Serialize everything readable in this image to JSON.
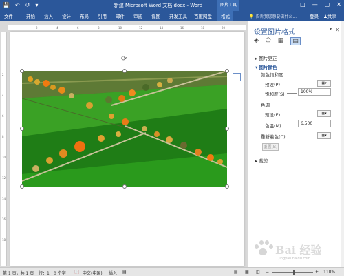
{
  "titlebar": {
    "doc_title": "新建 Microsoft Word 文档.docx - Word",
    "context_tool": "图片工具",
    "qat_icons": [
      "save-icon",
      "undo-icon",
      "redo-icon",
      "customize-icon"
    ]
  },
  "tabs": [
    {
      "label": "文件"
    },
    {
      "label": "开始"
    },
    {
      "label": "插入"
    },
    {
      "label": "设计"
    },
    {
      "label": "布局"
    },
    {
      "label": "引用"
    },
    {
      "label": "邮件"
    },
    {
      "label": "审阅"
    },
    {
      "label": "视图"
    },
    {
      "label": "开发工具"
    },
    {
      "label": "百度网盘"
    },
    {
      "label": "格式"
    }
  ],
  "tellme": "告诉我您想要做什么...",
  "login": "登录",
  "share": "共享",
  "pane": {
    "title": "设置图片格式",
    "sections": {
      "correction": "图片更正",
      "color": "图片颜色",
      "crop": "裁剪"
    },
    "saturation_group": "颜色饱和度",
    "saturation_preset": "预设(P)",
    "saturation_label": "饱和度(S)",
    "saturation_value": "100%",
    "tone_group": "色调",
    "tone_preset": "预设(E)",
    "temperature_label": "色温(M)",
    "temperature_value": "6,500",
    "recolor_label": "重新着色(C)",
    "reset_button": "重置(B)"
  },
  "status": {
    "page": "第 1 页，共 1 页",
    "line": "行：1",
    "words": "0 个字",
    "lang": "中文(中国)",
    "mode": "插入",
    "zoom": "110%"
  },
  "watermark": {
    "text": "Bai 经验",
    "sub": "jingyan.baidu.com"
  },
  "colors": {
    "ribbon": "#2b579a",
    "accent": "#3d6fb6"
  }
}
